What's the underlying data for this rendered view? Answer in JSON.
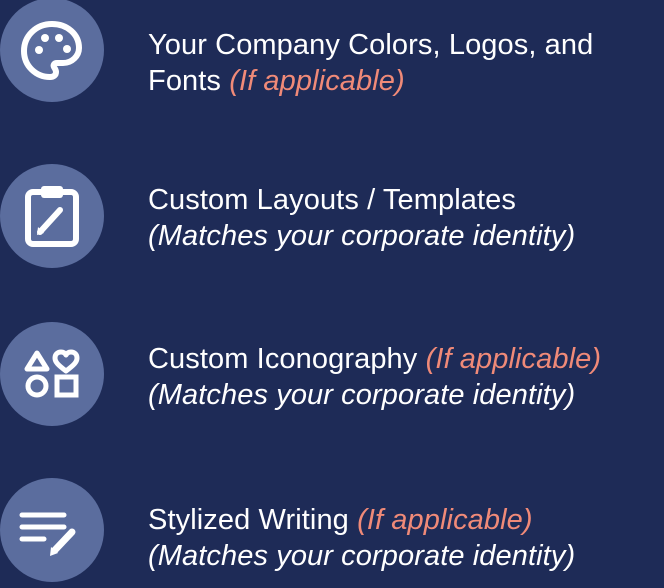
{
  "colors": {
    "background": "#1e2b57",
    "icon_circle": "#5b6d9e",
    "text": "#ffffff",
    "accent": "#f08a78"
  },
  "items": [
    {
      "icon": "palette-icon",
      "title_line1": "Your Company Colors, Logos, and",
      "title_line2": "Fonts",
      "note": "(If applicable)"
    },
    {
      "icon": "clipboard-edit-icon",
      "title": "Custom Layouts / Templates",
      "subtitle": "(Matches your corporate identity)"
    },
    {
      "icon": "shapes-icon",
      "title": "Custom Iconography",
      "note": "(If applicable)",
      "subtitle": "(Matches your corporate identity)"
    },
    {
      "icon": "text-edit-icon",
      "title": "Stylized Writing",
      "note": "(If applicable)",
      "subtitle": "(Matches your corporate identity)"
    }
  ]
}
